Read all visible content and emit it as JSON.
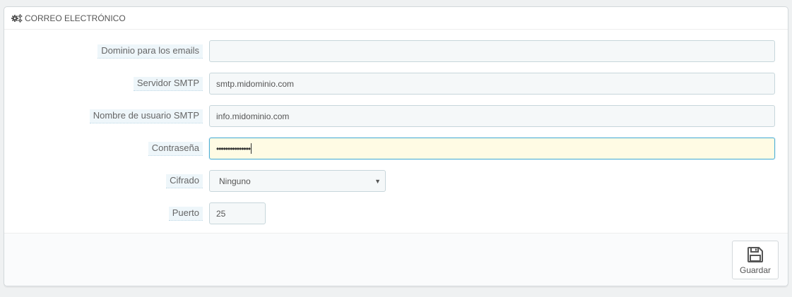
{
  "panel": {
    "title": "CORREO ELECTRÓNICO",
    "icon": "cogs-icon"
  },
  "form": {
    "domain": {
      "label": "Dominio para los emails",
      "value": ""
    },
    "smtp_server": {
      "label": "Servidor SMTP",
      "value": "smtp.midominio.com"
    },
    "smtp_user": {
      "label": "Nombre de usuario SMTP",
      "value": "info.midominio.com"
    },
    "password": {
      "label": "Contraseña",
      "masked_value": "•••••••••••••••"
    },
    "encryption": {
      "label": "Cifrado",
      "selected": "Ninguno"
    },
    "port": {
      "label": "Puerto",
      "value": "25"
    }
  },
  "footer": {
    "save_label": "Guardar",
    "save_icon": "save-icon"
  },
  "colors": {
    "label_bg": "#eef6fa",
    "focus_bg": "#fffbe4",
    "focus_border": "#50b0d6"
  }
}
